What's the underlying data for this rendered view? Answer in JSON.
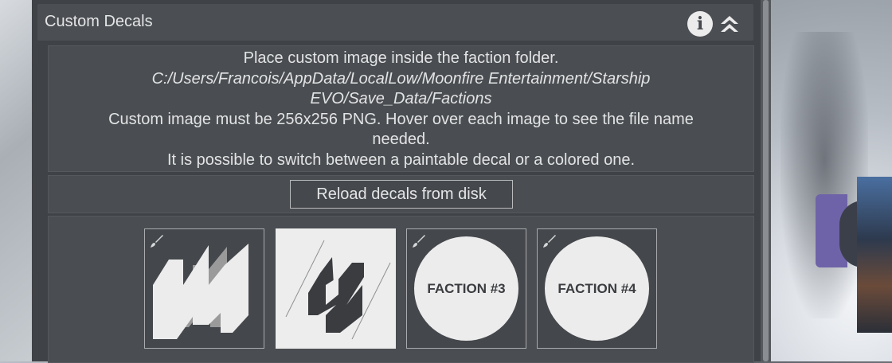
{
  "panel": {
    "title": "Custom Decals",
    "icons": {
      "info": "info-icon",
      "collapse": "chevron-up-double-icon"
    }
  },
  "info": {
    "line1": "Place custom image inside the faction folder.",
    "path_line1": "C:/Users/Francois/AppData/LocalLow/Moonfire Entertainment/Starship",
    "path_line2": "EVO/Save_Data/Factions",
    "line3": "Custom image must be 256x256 PNG. Hover over each image to see the file name",
    "line4": "needed.",
    "line5": "It is possible to switch between a paintable decal or a colored one."
  },
  "reload_label": "Reload decals from disk",
  "decals": [
    {
      "type": "logo",
      "paintable": true,
      "selected": false
    },
    {
      "type": "logo",
      "paintable": false,
      "selected": true
    },
    {
      "type": "circle",
      "text": "FACTION #3",
      "paintable": true,
      "selected": false
    },
    {
      "type": "circle",
      "text": "FACTION #4",
      "paintable": true,
      "selected": false
    }
  ],
  "colors": {
    "panel": "#3f4246",
    "section": "#4a4d51",
    "text": "#e2e3e4",
    "decal_light": "#ececec"
  }
}
